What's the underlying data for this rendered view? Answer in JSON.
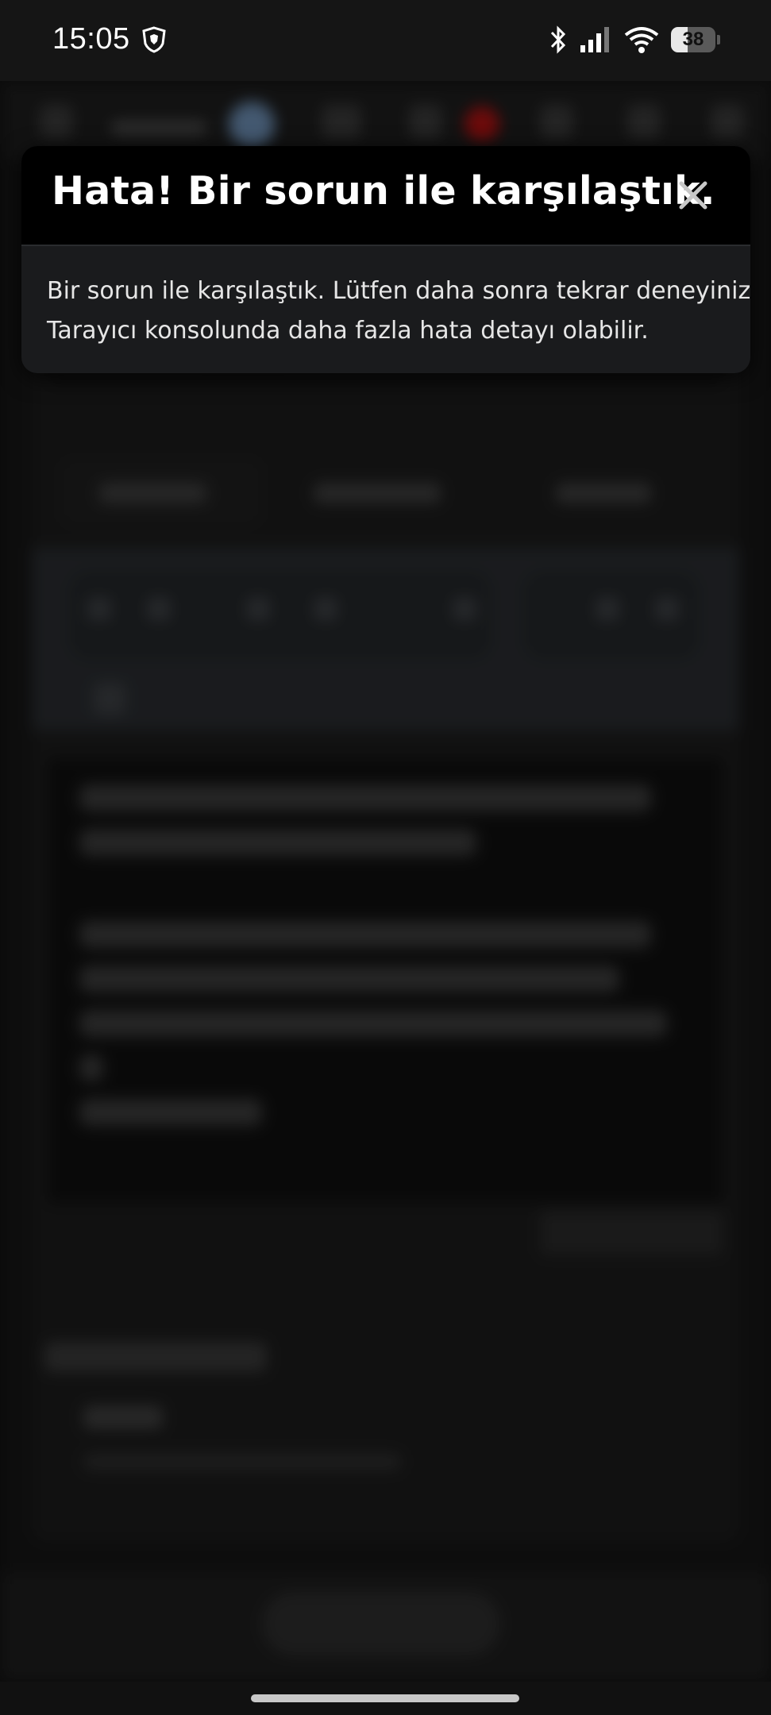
{
  "status_bar": {
    "time": "15:05",
    "battery_level": "38",
    "icons": [
      "brave-shield-icon",
      "bluetooth-icon",
      "signal-icon",
      "wifi-icon",
      "battery-icon"
    ]
  },
  "error_dialog": {
    "title": "Hata! Bir sorun ile karşılaştık.",
    "message_line_1": "Bir sorun ile karşılaştık. Lütfen daha sonra tekrar deneyiniz.",
    "message_line_2": "Tarayıcı konsolunda daha fazla hata detayı olabilir.",
    "close_icon": "close-icon"
  },
  "colors": {
    "dialog_header_bg": "#000000",
    "dialog_body_bg": "#1a1b1d",
    "overlay_bg": "#111111"
  }
}
